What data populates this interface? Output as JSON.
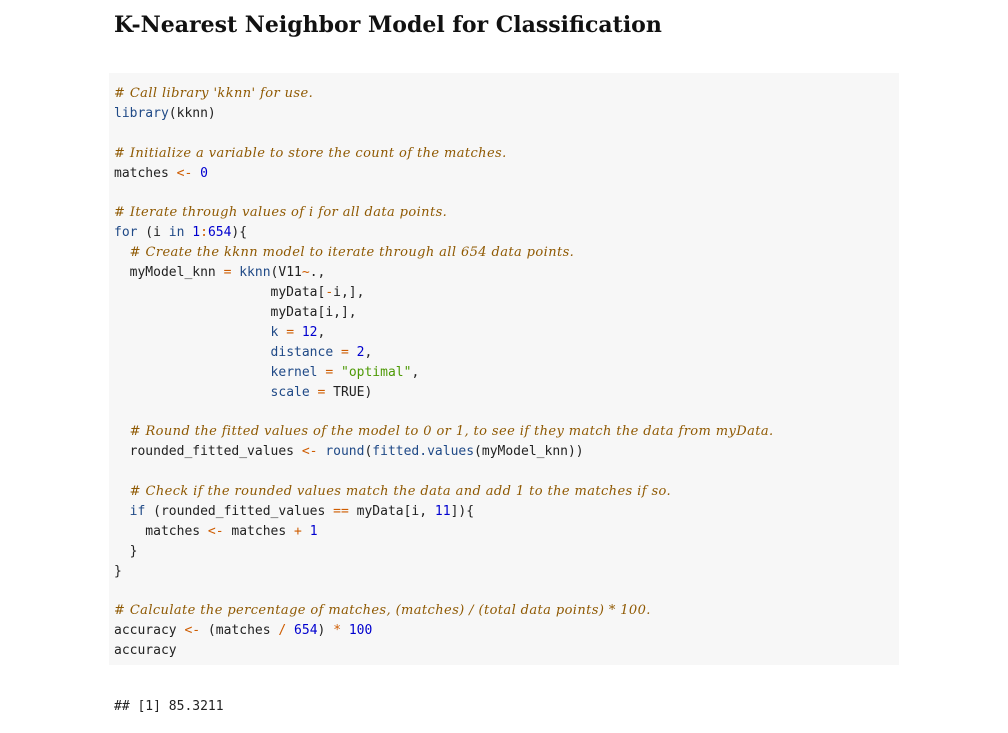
{
  "document": {
    "title": "K-Nearest Neighbor Model for Classification"
  },
  "code": {
    "lines": [
      [
        {
          "t": "comment",
          "v": "# Call library 'kknn' for use."
        }
      ],
      [
        {
          "t": "func",
          "v": "library"
        },
        {
          "t": "plain",
          "v": "(kknn)"
        }
      ],
      [],
      [
        {
          "t": "comment",
          "v": "# Initialize a variable to store the count of the matches."
        }
      ],
      [
        {
          "t": "plain",
          "v": "matches "
        },
        {
          "t": "operator",
          "v": "<-"
        },
        {
          "t": "plain",
          "v": " "
        },
        {
          "t": "number",
          "v": "0"
        }
      ],
      [],
      [
        {
          "t": "comment",
          "v": "# Iterate through values of i for all data points."
        }
      ],
      [
        {
          "t": "keyword",
          "v": "for"
        },
        {
          "t": "plain",
          "v": " (i "
        },
        {
          "t": "keyword",
          "v": "in"
        },
        {
          "t": "plain",
          "v": " "
        },
        {
          "t": "number",
          "v": "1"
        },
        {
          "t": "operator",
          "v": ":"
        },
        {
          "t": "number",
          "v": "654"
        },
        {
          "t": "plain",
          "v": "){"
        }
      ],
      [
        {
          "t": "plain",
          "v": "  "
        },
        {
          "t": "comment",
          "v": "# Create the kknn model to iterate through all 654 data points."
        }
      ],
      [
        {
          "t": "plain",
          "v": "  myModel_knn "
        },
        {
          "t": "operator",
          "v": "="
        },
        {
          "t": "plain",
          "v": " "
        },
        {
          "t": "func",
          "v": "kknn"
        },
        {
          "t": "plain",
          "v": "(V11"
        },
        {
          "t": "operator",
          "v": "~"
        },
        {
          "t": "plain",
          "v": ".,"
        }
      ],
      [
        {
          "t": "plain",
          "v": "                    myData["
        },
        {
          "t": "operator",
          "v": "-"
        },
        {
          "t": "plain",
          "v": "i,],"
        }
      ],
      [
        {
          "t": "plain",
          "v": "                    myData[i,],"
        }
      ],
      [
        {
          "t": "plain",
          "v": "                    "
        },
        {
          "t": "arg",
          "v": "k"
        },
        {
          "t": "plain",
          "v": " "
        },
        {
          "t": "operator",
          "v": "="
        },
        {
          "t": "plain",
          "v": " "
        },
        {
          "t": "number",
          "v": "12"
        },
        {
          "t": "plain",
          "v": ","
        }
      ],
      [
        {
          "t": "plain",
          "v": "                    "
        },
        {
          "t": "arg",
          "v": "distance"
        },
        {
          "t": "plain",
          "v": " "
        },
        {
          "t": "operator",
          "v": "="
        },
        {
          "t": "plain",
          "v": " "
        },
        {
          "t": "number",
          "v": "2"
        },
        {
          "t": "plain",
          "v": ","
        }
      ],
      [
        {
          "t": "plain",
          "v": "                    "
        },
        {
          "t": "arg",
          "v": "kernel"
        },
        {
          "t": "plain",
          "v": " "
        },
        {
          "t": "operator",
          "v": "="
        },
        {
          "t": "plain",
          "v": " "
        },
        {
          "t": "string",
          "v": "\"optimal\""
        },
        {
          "t": "plain",
          "v": ","
        }
      ],
      [
        {
          "t": "plain",
          "v": "                    "
        },
        {
          "t": "arg",
          "v": "scale"
        },
        {
          "t": "plain",
          "v": " "
        },
        {
          "t": "operator",
          "v": "="
        },
        {
          "t": "plain",
          "v": " TRUE)"
        }
      ],
      [],
      [
        {
          "t": "plain",
          "v": "  "
        },
        {
          "t": "comment",
          "v": "# Round the fitted values of the model to 0 or 1, to see if they match the data from myData."
        }
      ],
      [
        {
          "t": "plain",
          "v": "  rounded_fitted_values "
        },
        {
          "t": "operator",
          "v": "<-"
        },
        {
          "t": "plain",
          "v": " "
        },
        {
          "t": "func",
          "v": "round"
        },
        {
          "t": "plain",
          "v": "("
        },
        {
          "t": "func",
          "v": "fitted.values"
        },
        {
          "t": "plain",
          "v": "(myModel_knn))"
        }
      ],
      [],
      [
        {
          "t": "plain",
          "v": "  "
        },
        {
          "t": "comment",
          "v": "# Check if the rounded values match the data and add 1 to the matches if so."
        }
      ],
      [
        {
          "t": "plain",
          "v": "  "
        },
        {
          "t": "keyword",
          "v": "if"
        },
        {
          "t": "plain",
          "v": " (rounded_fitted_values "
        },
        {
          "t": "operator",
          "v": "=="
        },
        {
          "t": "plain",
          "v": " myData[i, "
        },
        {
          "t": "number",
          "v": "11"
        },
        {
          "t": "plain",
          "v": "]){"
        }
      ],
      [
        {
          "t": "plain",
          "v": "    matches "
        },
        {
          "t": "operator",
          "v": "<-"
        },
        {
          "t": "plain",
          "v": " matches "
        },
        {
          "t": "operator",
          "v": "+"
        },
        {
          "t": "plain",
          "v": " "
        },
        {
          "t": "number",
          "v": "1"
        }
      ],
      [
        {
          "t": "plain",
          "v": "  }"
        }
      ],
      [
        {
          "t": "plain",
          "v": "}"
        }
      ],
      [],
      [
        {
          "t": "comment",
          "v": "# Calculate the percentage of matches, (matches) / (total data points) * 100."
        }
      ],
      [
        {
          "t": "plain",
          "v": "accuracy "
        },
        {
          "t": "operator",
          "v": "<-"
        },
        {
          "t": "plain",
          "v": " (matches "
        },
        {
          "t": "operator",
          "v": "/"
        },
        {
          "t": "plain",
          "v": " "
        },
        {
          "t": "number",
          "v": "654"
        },
        {
          "t": "plain",
          "v": ") "
        },
        {
          "t": "operator",
          "v": "*"
        },
        {
          "t": "plain",
          "v": " "
        },
        {
          "t": "number",
          "v": "100"
        }
      ],
      [
        {
          "t": "plain",
          "v": "accuracy"
        }
      ]
    ]
  },
  "output": {
    "text": "## [1] 85.3211"
  },
  "colors": {
    "code_background": "#f7f7f7",
    "comment": "#8f5902",
    "keyword": "#204a87",
    "number": "#0000cf",
    "string": "#4e9a06",
    "operator": "#ce5c00"
  }
}
